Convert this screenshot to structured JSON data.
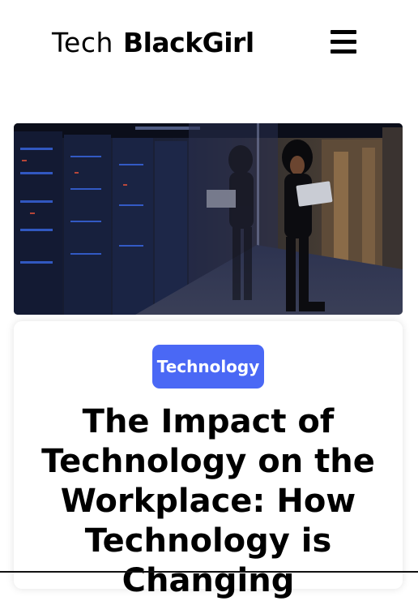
{
  "header": {
    "logo_light": "Tech",
    "logo_bold": "BlackGirl",
    "menu_icon": "hamburger-menu-icon"
  },
  "hero": {
    "image_description": "woman holding laptop in server room hallway"
  },
  "article": {
    "category": "Technology",
    "title": "The Impact of Technology on the Workplace: How Technology is Changing"
  },
  "colors": {
    "badge_bg": "#4a68f5",
    "text": "#000000",
    "background": "#ffffff"
  }
}
